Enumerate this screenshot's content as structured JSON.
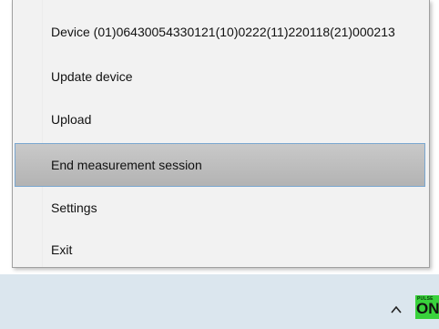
{
  "menu": {
    "items": [
      {
        "label": "Device (01)06430054330121(10)0222(11)220118(21)000213"
      },
      {
        "label": "Update device"
      },
      {
        "label": "Upload"
      },
      {
        "label": "End measurement session"
      },
      {
        "label": "Settings"
      },
      {
        "label": "Exit"
      }
    ],
    "highlighted_index": 3
  },
  "tray": {
    "chevron_icon": "chevron-up-icon",
    "app_icon": "pulseon-icon",
    "logo_small": "PULSE",
    "logo_big": "ON"
  },
  "colors": {
    "menu_bg": "#f2f2f2",
    "highlight_bg": "#bdbdbd",
    "highlight_border": "#7aa7d0",
    "taskbar_bg": "#dbe6ee",
    "logo_green": "#39d23c"
  }
}
